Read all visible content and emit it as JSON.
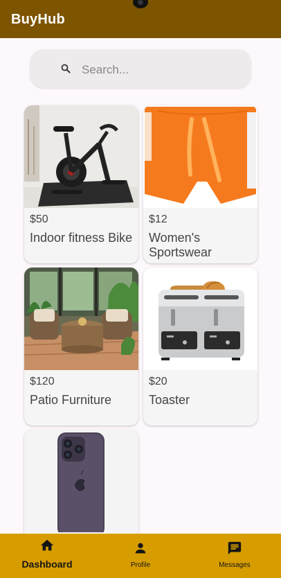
{
  "app": {
    "title": "BuyHub"
  },
  "search": {
    "placeholder": "Search..."
  },
  "products": [
    {
      "price": "$50",
      "name": "Indoor fitness Bike"
    },
    {
      "price": "$12",
      "name": "Women's Sportswear"
    },
    {
      "price": "$120",
      "name": "Patio Furniture"
    },
    {
      "price": "$20",
      "name": "Toaster"
    },
    {
      "price": "",
      "name": ""
    }
  ],
  "nav": {
    "items": [
      {
        "label": "Dashboard",
        "icon": "home-icon",
        "active": true
      },
      {
        "label": "Profile",
        "icon": "person-icon",
        "active": false
      },
      {
        "label": "Messages",
        "icon": "message-icon",
        "active": false
      }
    ]
  },
  "colors": {
    "appbar": "#7d5500",
    "bottom_nav": "#d79d00",
    "background": "#fdf8fb",
    "search_bg": "#eeebec",
    "card_bg": "#f5f5f5"
  }
}
